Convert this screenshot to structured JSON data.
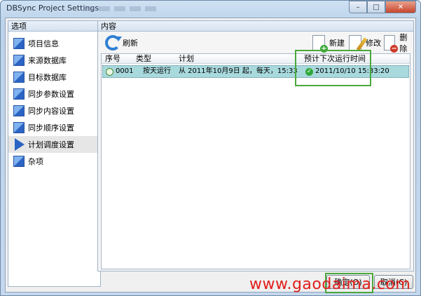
{
  "window": {
    "title": "DBSync Project Settings",
    "minimize_glyph": "–",
    "maximize_glyph": "□",
    "close_glyph": "✕"
  },
  "sidebar": {
    "header": "选项",
    "items": [
      {
        "label": "项目信息",
        "icon": "settings-page-icon"
      },
      {
        "label": "来源数据库",
        "icon": "settings-page-icon"
      },
      {
        "label": "目标数据库",
        "icon": "settings-page-icon"
      },
      {
        "label": "同步参数设置",
        "icon": "settings-page-icon"
      },
      {
        "label": "同步内容设置",
        "icon": "settings-page-icon"
      },
      {
        "label": "同步顺序设置",
        "icon": "settings-page-icon"
      },
      {
        "label": "计划调度设置",
        "icon": "play-arrow-icon",
        "selected": true
      },
      {
        "label": "杂项",
        "icon": "settings-page-icon"
      }
    ]
  },
  "content": {
    "header": "内容",
    "toolbar": {
      "refresh_label": "刷新",
      "new_label": "新建",
      "edit_label": "修改",
      "delete_label": "删除"
    },
    "table": {
      "columns": [
        "序号",
        "类型",
        "计划",
        "预计下次运行时间"
      ],
      "rows": [
        {
          "id": "0001",
          "type": "按天运行",
          "plan": "从 2011年10月9日 起，每天，15:33",
          "next_run": "2011/10/10 15:33:20"
        }
      ]
    }
  },
  "footer": {
    "ok_label": "确定(O)",
    "cancel_label": "取消(C)"
  },
  "watermark": "www.gaodaima.com",
  "colors": {
    "selected_row": "#a8d9dd",
    "highlight_box": "#4aa83a",
    "watermark": "#e0201c"
  }
}
